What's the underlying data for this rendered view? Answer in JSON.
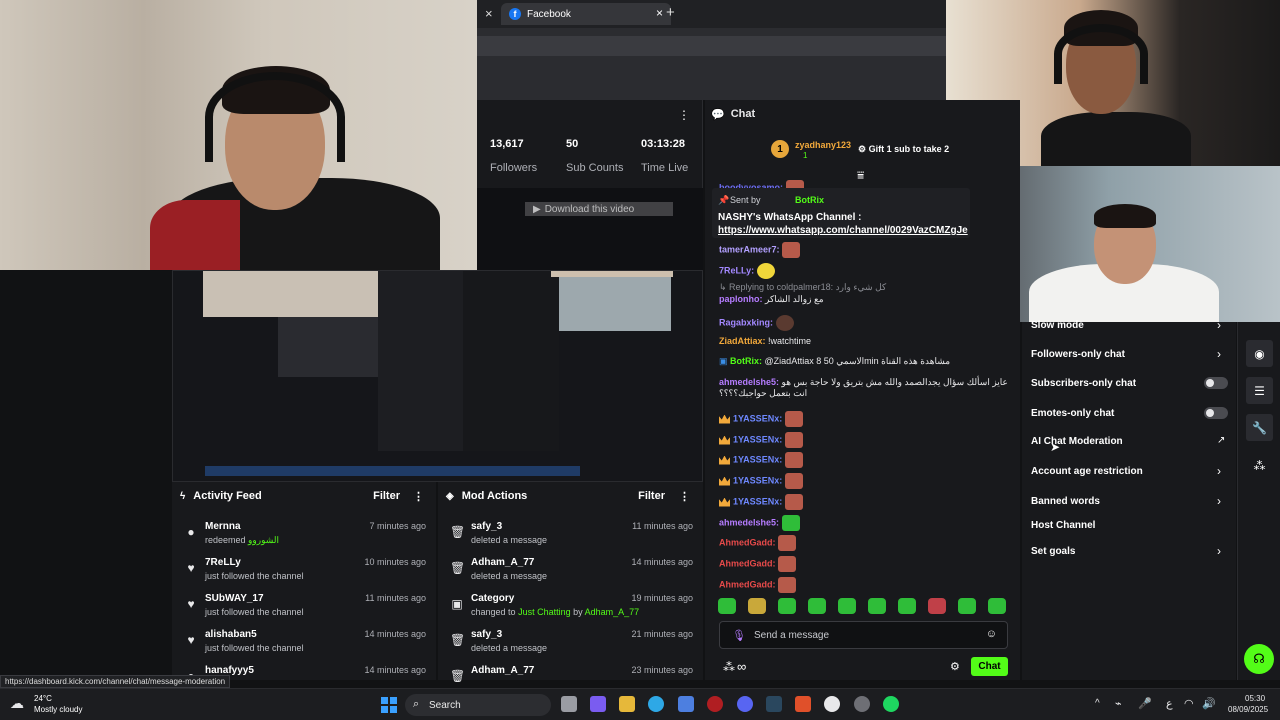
{
  "browser": {
    "tab_title": "Facebook",
    "close_glyph": "×",
    "new_tab_glyph": "+"
  },
  "stats": [
    {
      "value": "13,617",
      "label": "Followers"
    },
    {
      "value": "50",
      "label": "Sub Counts"
    },
    {
      "value": "03:13:28",
      "label": "Time Live"
    }
  ],
  "player": {
    "download_label": "Download this video"
  },
  "activity_feed": {
    "title": "Activity Feed",
    "filter": "Filter",
    "items": [
      {
        "icon": "redeem-icon",
        "name": "Mernna",
        "desc": "redeemed",
        "highlight": "الشوروو",
        "time": "7 minutes ago"
      },
      {
        "icon": "heart-icon",
        "name": "7ReLLy",
        "desc": "just followed the channel",
        "time": "10 minutes ago"
      },
      {
        "icon": "heart-icon",
        "name": "SUbWAY_17",
        "desc": "just followed the channel",
        "time": "11 minutes ago"
      },
      {
        "icon": "heart-icon",
        "name": "alishaban5",
        "desc": "just followed the channel",
        "time": "14 minutes ago"
      },
      {
        "icon": "redeem-icon",
        "name": "hanafyyy5",
        "desc": "",
        "time": "14 minutes ago"
      }
    ]
  },
  "mod_actions": {
    "title": "Mod Actions",
    "filter": "Filter",
    "items": [
      {
        "icon": "trash-icon",
        "name": "safy_3",
        "desc": "deleted a message",
        "time": "11 minutes ago"
      },
      {
        "icon": "trash-icon",
        "name": "Adham_A_77",
        "desc": "deleted a message",
        "time": "14 minutes ago"
      },
      {
        "icon": "category-icon",
        "name": "Category",
        "desc": "changed to",
        "highlight": "Just Chatting",
        "by": "by",
        "actor": "Adham_A_77",
        "time": "19 minutes ago"
      },
      {
        "icon": "trash-icon",
        "name": "safy_3",
        "desc": "deleted a message",
        "time": "21 minutes ago"
      },
      {
        "icon": "trash-icon",
        "name": "Adham_A_77",
        "desc": "",
        "time": "23 minutes ago"
      }
    ]
  },
  "chat": {
    "title": "Chat",
    "top_gifter": {
      "rank": "1",
      "name": "zyadhany123",
      "count": "1"
    },
    "gift_label": "Gift 1 sub to take 2",
    "pinned": {
      "sent_by": "Sent by",
      "bot": "BotRix",
      "text": "NASHY's WhatsApp Channel :",
      "link": "https://www.whatsapp.com/channel/0029VazCMZgJe"
    },
    "messages": [
      {
        "user": "boodyyosamo:",
        "color": "#6e6ef5",
        "text": ""
      },
      {
        "user": "tamerAmeer7:",
        "color": "#b2a0ff",
        "text": ""
      },
      {
        "user": "7ReLLy:",
        "color": "#a388ff",
        "text": ""
      },
      {
        "reply": "Replying to coldpalmer18:",
        "reply_text": "كل شيء وارد",
        "user": "paplonho:",
        "color": "#b57cff",
        "text": "مع زوالد الشاكر"
      },
      {
        "user": "Ragabxking:",
        "color": "#a388ff",
        "text": ""
      },
      {
        "user": "ZiadAttiax:",
        "color": "#f2a93b",
        "text": "!watchtime"
      },
      {
        "user": "BotRix:",
        "color": "#53fc18",
        "text": "@ZiadAttiax 8 الاسمي 50min مشاهدة هذه القناة"
      },
      {
        "user": "ahmedelshe5:",
        "color": "#b57cff",
        "text": "عايز اسألك سؤال يجدالصمد والله مش بتريق ولا حاجة بس هو انت بتعمل حواجبك؟؟؟؟"
      },
      {
        "user": "1YASSENx:",
        "color": "#6e88ff",
        "text": ""
      },
      {
        "user": "1YASSENx:",
        "color": "#6e88ff",
        "text": ""
      },
      {
        "user": "1YASSENx:",
        "color": "#6e88ff",
        "text": ""
      },
      {
        "user": "1YASSENx:",
        "color": "#6e88ff",
        "text": ""
      },
      {
        "user": "1YASSENx:",
        "color": "#6e88ff",
        "text": ""
      },
      {
        "user": "ahmedelshe5:",
        "color": "#b57cff",
        "text": ""
      },
      {
        "user": "AhmedGadd:",
        "color": "#e64a4a",
        "text": ""
      },
      {
        "user": "AhmedGadd:",
        "color": "#e64a4a",
        "text": ""
      },
      {
        "user": "AhmedGadd:",
        "color": "#e64a4a",
        "text": ""
      }
    ],
    "input_placeholder": "Send a message",
    "send_label": "Chat",
    "infinity": "∞"
  },
  "settings": {
    "items": [
      {
        "label": "Slow mode",
        "control": "chevron"
      },
      {
        "label": "Followers-only chat",
        "control": "chevron"
      },
      {
        "label": "Subscribers-only chat",
        "control": "toggle"
      },
      {
        "label": "Emotes-only chat",
        "control": "toggle"
      },
      {
        "label": "AI Chat Moderation",
        "control": "external"
      },
      {
        "label": "Account age restriction",
        "control": "chevron"
      },
      {
        "label": "Banned words",
        "control": "chevron"
      },
      {
        "label": "Host Channel",
        "control": "none"
      },
      {
        "label": "Set goals",
        "control": "chevron"
      }
    ]
  },
  "status_url": "https://dashboard.kick.com/channel/chat/message-moderation",
  "taskbar": {
    "weather_temp": "24°C",
    "weather_desc": "Mostly cloudy",
    "search_label": "Search",
    "time": "05:30",
    "date": "08/09/2025",
    "lang": "ع"
  },
  "colors": {
    "accent": "#53fc18",
    "panel": "#18191c"
  }
}
